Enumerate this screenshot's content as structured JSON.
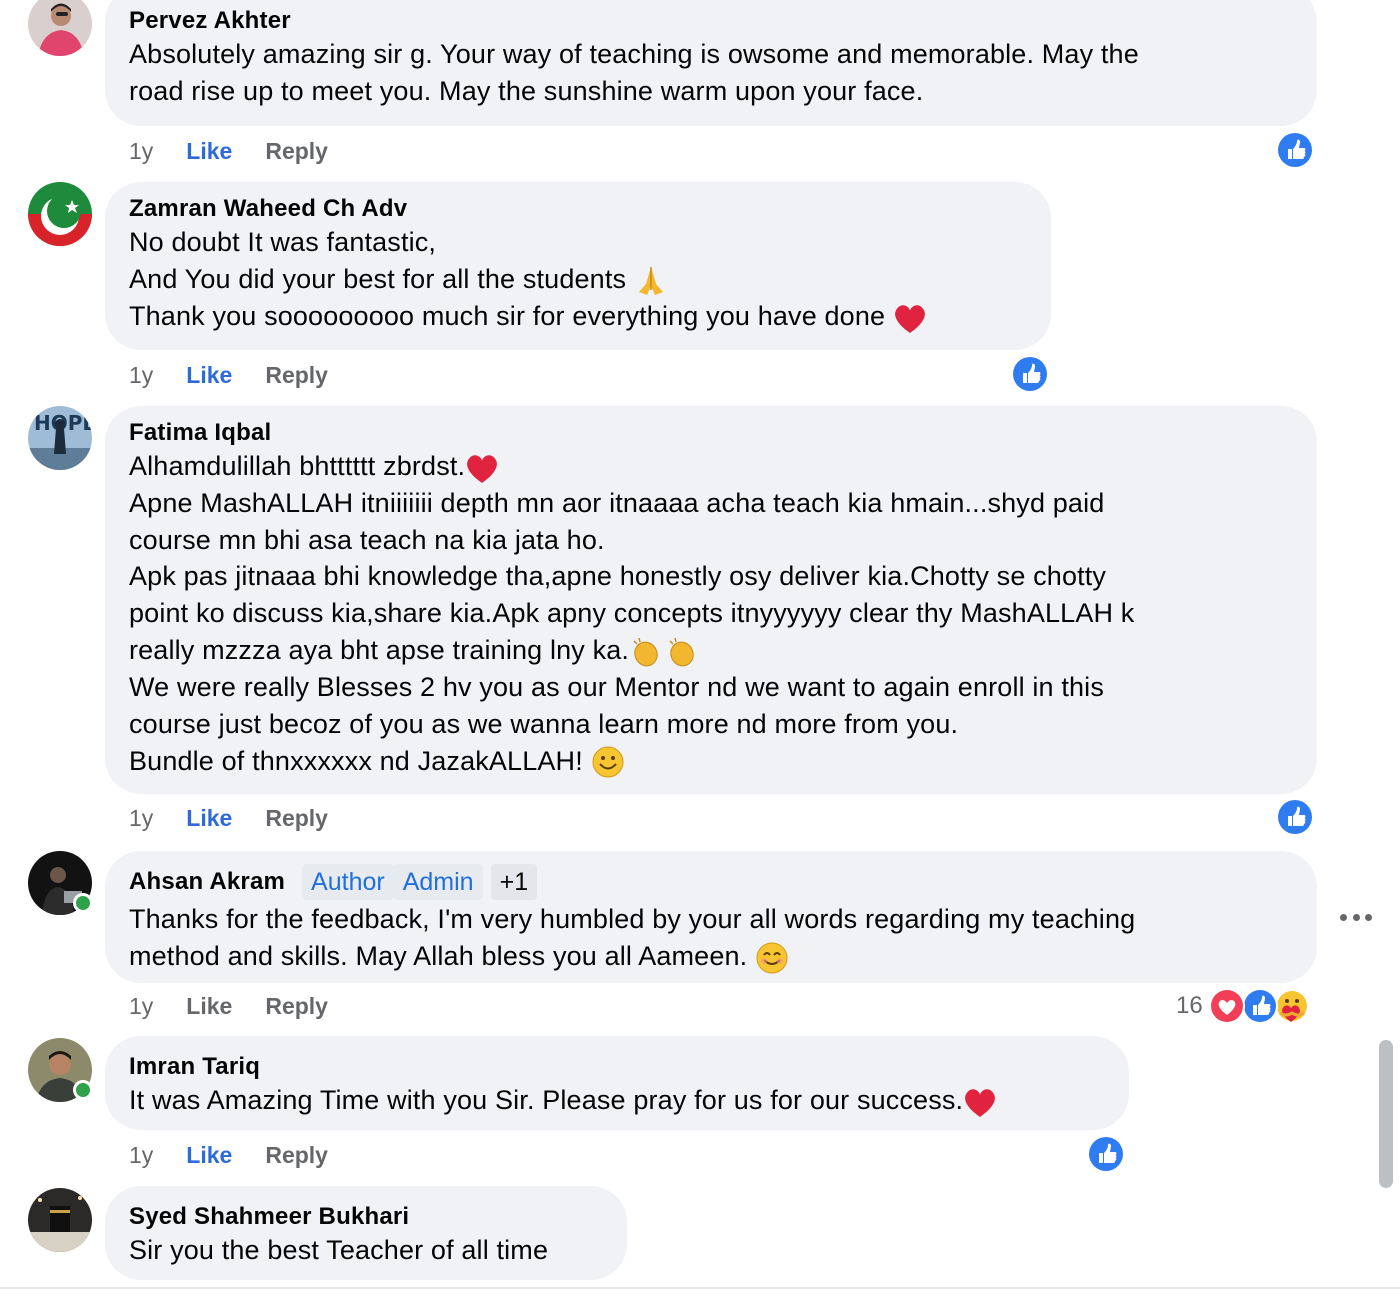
{
  "comments": [
    {
      "author": "Pervez Akhter",
      "lines": "Absolutely amazing sir g. Your way of teaching is owsome and memorable. May the\nroad rise up to meet you. May the sunshine warm upon your face.",
      "time": "1y",
      "like": "Like",
      "reply": "Reply",
      "reaction_icon": "like-icon"
    },
    {
      "author": "Zamran Waheed Ch Adv",
      "line1": "No doubt It was fantastic,",
      "line2": "And You did your best for all the students ",
      "line3": "Thank you sooooooooo much sir for everything you have done ",
      "line2_emoji": "folded-hands-emoji",
      "line3_emoji": "red-heart-emoji",
      "time": "1y",
      "like": "Like",
      "reply": "Reply",
      "reaction_icon": "like-icon"
    },
    {
      "author": "Fatima Iqbal",
      "line1": "Alhamdulillah bhtttttt zbrdst.",
      "line1_emoji": "red-heart-emoji",
      "body": "Apne MashALLAH itniiiiiii depth mn aor itnaaaa acha teach kia hmain...shyd paid\ncourse mn bhi asa teach na kia jata ho.\nApk pas jitnaaa bhi knowledge tha,apne honestly osy deliver kia.Chotty se chotty\npoint ko discuss kia,share kia.Apk apny concepts itnyyyyyy clear thy MashALLAH k",
      "line_clap": "really mzzza aya bht apse training lny ka.",
      "line_clap_emoji": "clapping-hands-emoji",
      "body2": "We were really Blesses 2 hv you as our Mentor nd we want to again enroll in this\ncourse just becoz of you as we wanna learn more nd more from you.",
      "last": "Bundle of thnxxxxxx nd JazakALLAH! ",
      "last_emoji": "smiling-face-emoji",
      "time": "1y",
      "like": "Like",
      "reply": "Reply",
      "reaction_icon": "like-icon"
    },
    {
      "author": "Ahsan Akram",
      "badge_author": "Author",
      "badge_admin": "Admin",
      "badge_more": "+1",
      "lines": "Thanks for the feedback, I'm very humbled by your all words regarding my teaching\nmethod and skills. May Allah bless you all Aameen. ",
      "line_emoji": "smiling-eyes-emoji",
      "time": "1y",
      "like": "Like",
      "reply": "Reply",
      "reaction_count": "16",
      "reaction_icons": [
        "love-icon",
        "like-icon",
        "care-icon"
      ],
      "more_options": "more-options-icon",
      "online": true
    },
    {
      "author": "Imran Tariq",
      "lines": "It was Amazing Time with you Sir. Please pray for us for our success.",
      "line_emoji": "red-heart-emoji",
      "time": "1y",
      "like": "Like",
      "reply": "Reply",
      "reaction_icon": "like-icon",
      "online": true
    },
    {
      "author": "Syed Shahmeer Bukhari",
      "lines": "Sir you the best Teacher of all time"
    }
  ],
  "colors": {
    "bubble": "#f0f2f5",
    "like_blue": "#2e6bd8",
    "meta_gray": "#65676b",
    "badge_blue": "#216fdb",
    "reaction_blue": "#2f7cf0",
    "love_red": "#f33e58",
    "online_green": "#31a24c"
  }
}
